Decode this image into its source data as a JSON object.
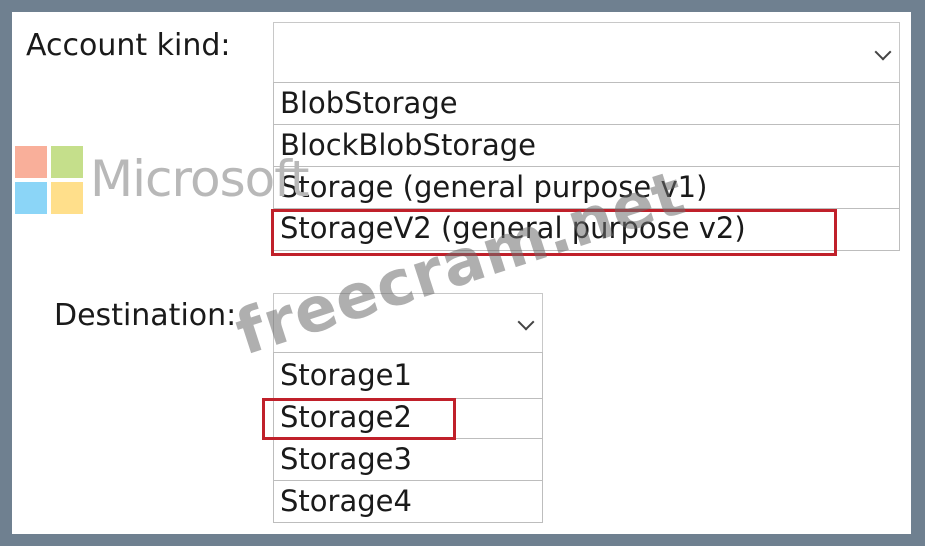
{
  "account_kind": {
    "label": "Account kind:",
    "selected_value": "",
    "options": [
      "BlobStorage",
      "BlockBlobStorage",
      "Storage (general purpose v1)",
      "StorageV2 (general purpose v2)"
    ],
    "highlighted_option": "StorageV2 (general purpose v2)"
  },
  "destination": {
    "label": "Destination:",
    "selected_value": "",
    "options": [
      "Storage1",
      "Storage2",
      "Storage3",
      "Storage4"
    ],
    "highlighted_option": "Storage2"
  },
  "watermarks": {
    "logo_text": "Microsoft",
    "site_text": "freecram.net"
  },
  "colors": {
    "frame": "#6f8090",
    "highlight": "#c0202a",
    "logo_red": "#f25022",
    "logo_green": "#7fba00",
    "logo_blue": "#00a4ef",
    "logo_yellow": "#ffb900"
  }
}
